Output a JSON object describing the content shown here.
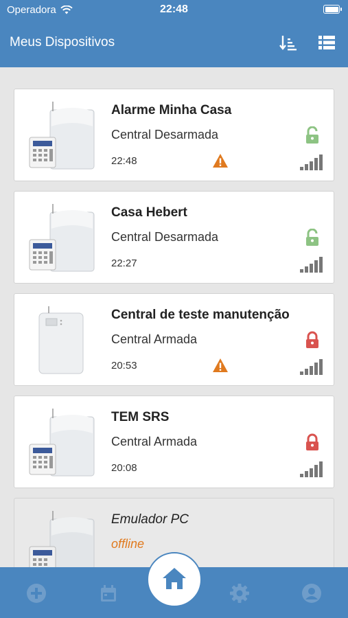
{
  "status_bar": {
    "carrier": "Operadora",
    "time": "22:48"
  },
  "header": {
    "title": "Meus Dispositivos"
  },
  "devices": [
    {
      "name": "Alarme Minha Casa",
      "state": "Central Desarmada",
      "time": "22:48",
      "lock": "unlocked",
      "warning": true,
      "model": "keypad"
    },
    {
      "name": "Casa Hebert",
      "state": "Central Desarmada",
      "time": "22:27",
      "lock": "unlocked",
      "warning": false,
      "model": "keypad"
    },
    {
      "name": "Central de teste manutenção",
      "state": "Central Armada",
      "time": "20:53",
      "lock": "locked",
      "warning": true,
      "model": "panel"
    },
    {
      "name": "TEM SRS",
      "state": "Central Armada",
      "time": "20:08",
      "lock": "locked",
      "warning": false,
      "model": "keypad"
    },
    {
      "name": "Emulador PC",
      "state": "offline",
      "time": "",
      "lock": "none",
      "warning": false,
      "model": "keypad"
    }
  ],
  "colors": {
    "primary": "#4a86bf",
    "unlocked": "#8dc383",
    "locked": "#d9534f",
    "warning": "#e07a1f",
    "offline_text": "#e07a1f"
  },
  "tabbar": {
    "items": [
      "add-icon",
      "calendar-icon",
      "home-icon",
      "settings-icon",
      "user-icon"
    ]
  }
}
